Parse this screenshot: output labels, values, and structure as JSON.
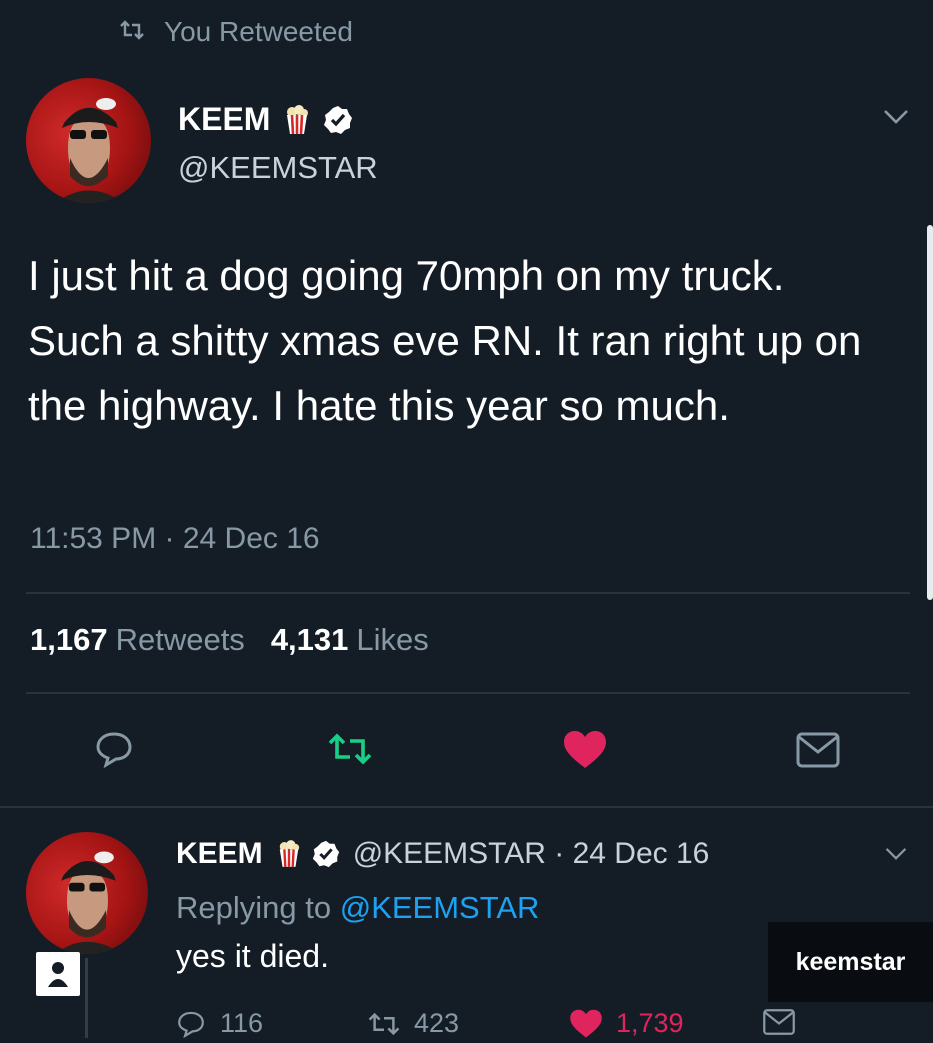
{
  "retweet_header": {
    "label": "You Retweeted",
    "icon": "retweet-icon"
  },
  "main_tweet": {
    "author_name": "KEEM",
    "author_emoji": "popcorn-icon",
    "verified_icon": "verified-badge-icon",
    "handle": "@KEEMSTAR",
    "text": "I just hit a dog going 70mph on my truck. Such a shitty xmas eve RN. It ran right up on the highway. I hate this year so much.",
    "timestamp": "11:53 PM · 24 Dec 16",
    "retweets_count": "1,167",
    "retweets_label": "Retweets",
    "likes_count": "4,131",
    "likes_label": "Likes",
    "actions": [
      "reply-icon",
      "retweet-icon",
      "like-heart-icon",
      "message-icon"
    ]
  },
  "reply_tweet": {
    "author_name": "KEEM",
    "handle_date": "@KEEMSTAR · 24 Dec 16",
    "replying_prefix": "Replying to ",
    "replying_handle": "@KEEMSTAR",
    "text": "yes it died.",
    "reply_count": "116",
    "retweet_count": "423",
    "like_count": "1,739"
  },
  "watermark": "keemstar",
  "colors": {
    "background": "#141d26",
    "retweet_active": "#19cf86",
    "like_active": "#e0245e",
    "link": "#1da1f2",
    "muted": "#8899a6"
  }
}
